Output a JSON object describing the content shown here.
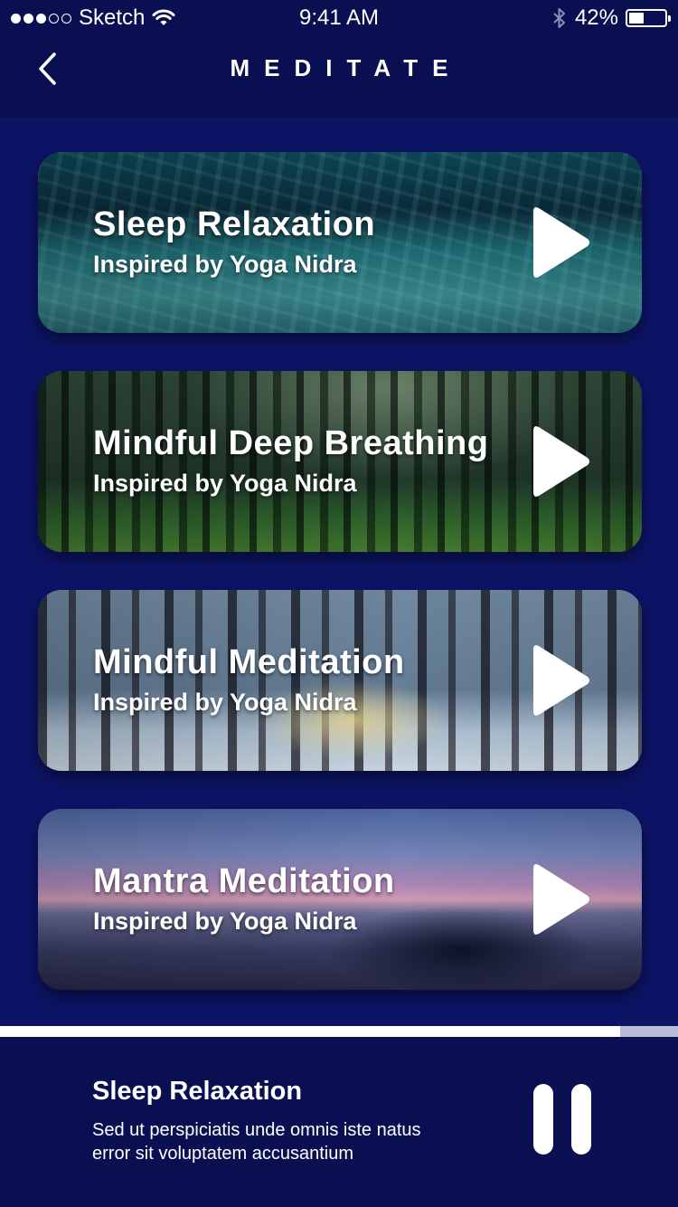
{
  "status_bar": {
    "carrier": "Sketch",
    "time": "9:41 AM",
    "battery_percent": "42%",
    "battery_level": 0.42,
    "signal_bars_filled": 3,
    "signal_bars_total": 5,
    "icons": [
      "wifi-icon",
      "bluetooth-icon",
      "battery-icon"
    ]
  },
  "header": {
    "title": "MEDITATE",
    "back_icon": "chevron-left-icon"
  },
  "sessions": [
    {
      "title": "Sleep Relaxation",
      "subtitle": "Inspired by Yoga Nidra",
      "background": "underwater"
    },
    {
      "title": "Mindful Deep Breathing",
      "subtitle": "Inspired by Yoga Nidra",
      "background": "forest"
    },
    {
      "title": "Mindful Meditation",
      "subtitle": "Inspired by Yoga Nidra",
      "background": "snowy-forest-sunrise"
    },
    {
      "title": "Mantra Meditation",
      "subtitle": "Inspired by Yoga Nidra",
      "background": "lake-boat-sunset"
    }
  ],
  "now_playing": {
    "title": "Sleep Relaxation",
    "description": "Sed ut perspiciatis unde omnis iste natus error sit voluptatem accusantium",
    "progress": 0.915,
    "control_icon": "pause-icon"
  },
  "colors": {
    "background": "#0d1466",
    "bar_background": "#0a0f52",
    "text": "#ffffff",
    "progress_track": "#b8bcd6"
  }
}
